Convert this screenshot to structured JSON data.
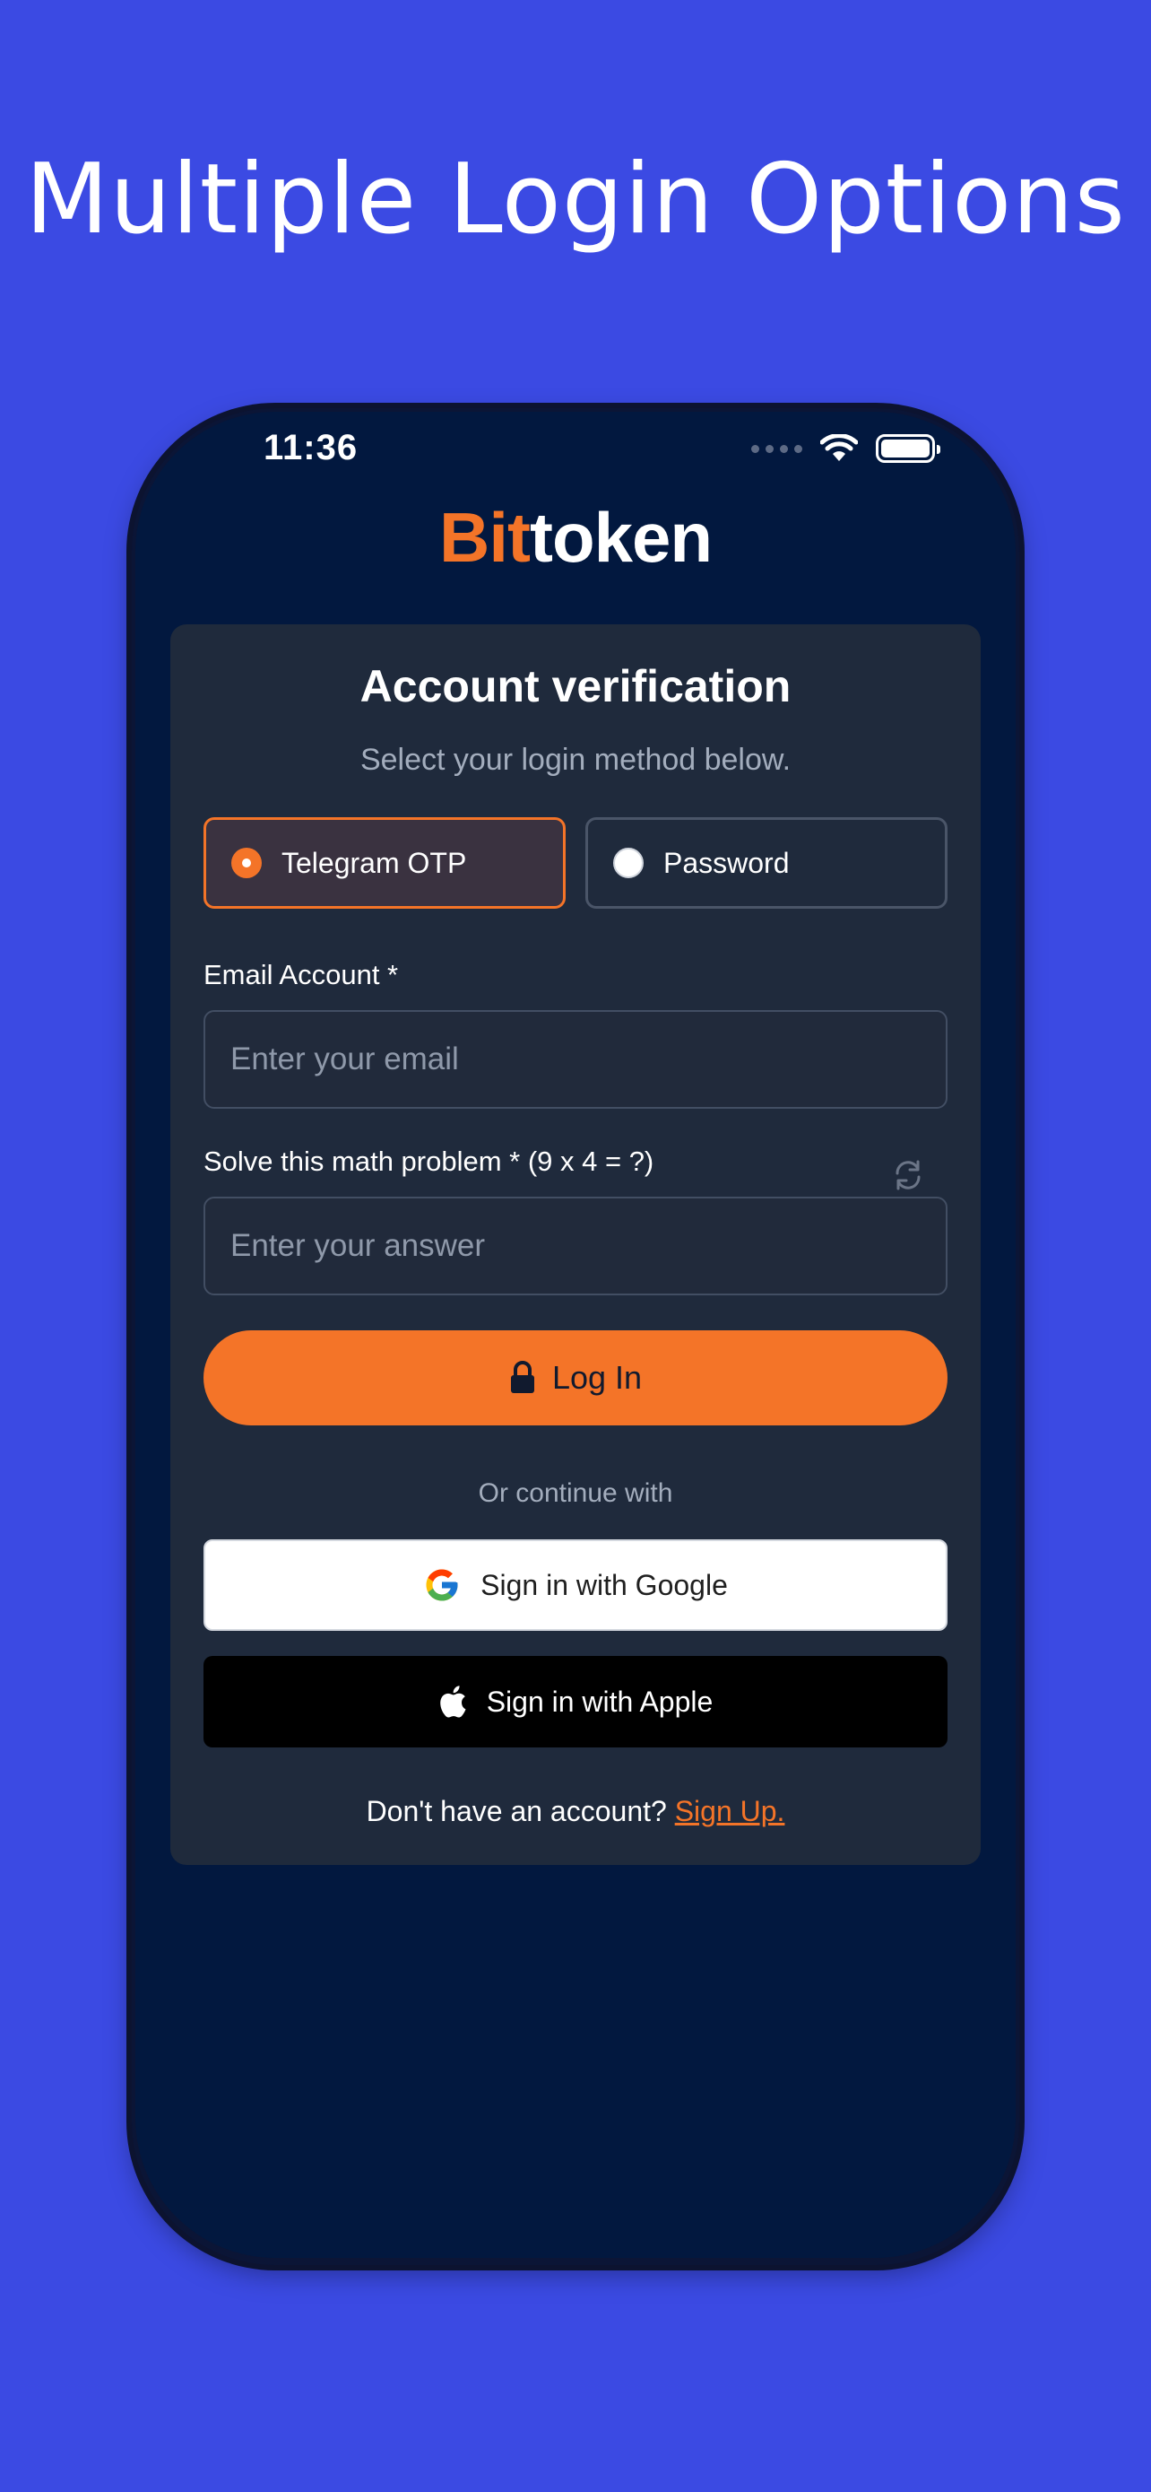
{
  "headline": "Multiple Login Options",
  "status_bar": {
    "time": "11:36"
  },
  "brand": {
    "part1": "Bit",
    "part2": "token"
  },
  "card": {
    "title": "Account verification",
    "subtitle": "Select your login method below.",
    "options": [
      {
        "label": "Telegram OTP",
        "selected": true
      },
      {
        "label": "Password",
        "selected": false
      }
    ],
    "email_label": "Email Account *",
    "email_placeholder": "Enter your email",
    "math_label": "Solve this math problem * (9 x 4 = ?)",
    "answer_placeholder": "Enter your answer",
    "login_label": "Log In",
    "divider_text": "Or continue with",
    "google_label": "Sign in with Google",
    "apple_label": "Sign in with Apple",
    "signup_prompt": "Don't have an account?",
    "signup_link": "Sign Up."
  },
  "colors": {
    "background": "#3b4ae3",
    "accent": "#f47428",
    "screen": "#02183f",
    "card": "#1f2a3c"
  }
}
